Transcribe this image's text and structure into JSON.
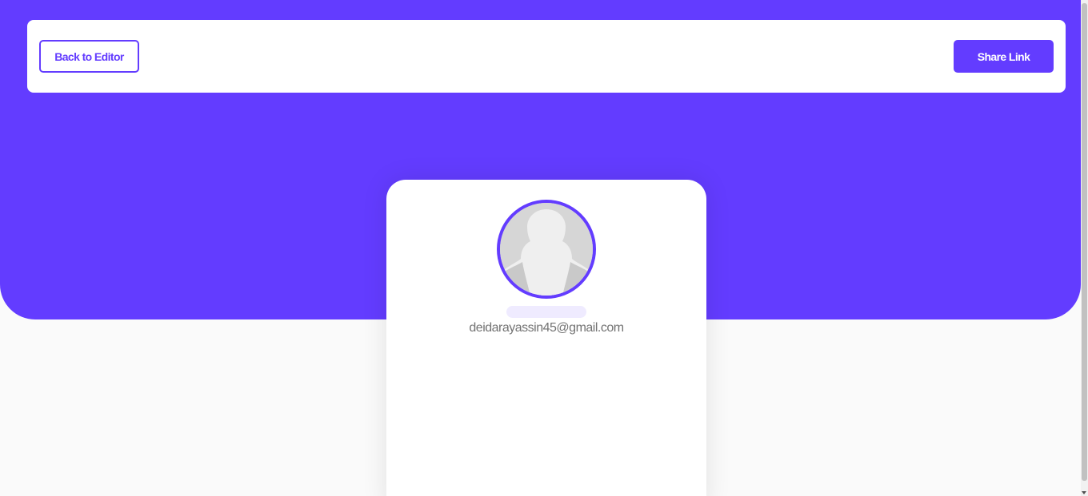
{
  "navbar": {
    "back_label": "Back to Editor",
    "share_label": "Share Link"
  },
  "profile": {
    "name": "",
    "email": "deidarayassin45@gmail.com"
  },
  "colors": {
    "accent": "#633cff",
    "background": "#fafafa",
    "text_muted": "#737373",
    "name_placeholder": "#efebff"
  },
  "icons": {
    "avatar": "default-avatar-silhouette"
  }
}
